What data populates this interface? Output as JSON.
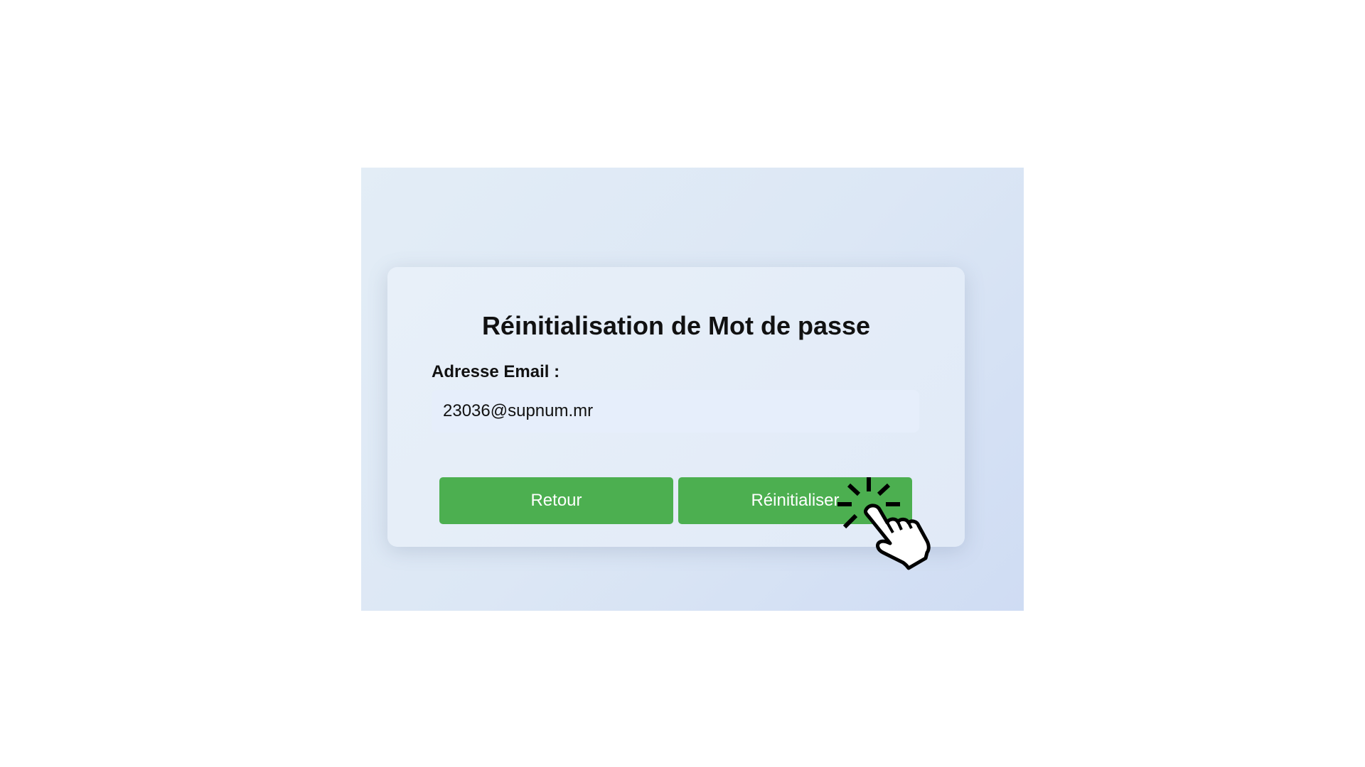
{
  "form": {
    "title": "Réinitialisation de Mot de passe",
    "email_label": "Adresse Email :",
    "email_value": "23036@supnum.mr",
    "back_label": "Retour",
    "reset_label": "Réinitialiser"
  },
  "colors": {
    "button": "#4caf50",
    "button_text": "#ffffff",
    "input_bg": "#e6eefb"
  },
  "icons": {
    "cursor": "click-hand-icon"
  }
}
